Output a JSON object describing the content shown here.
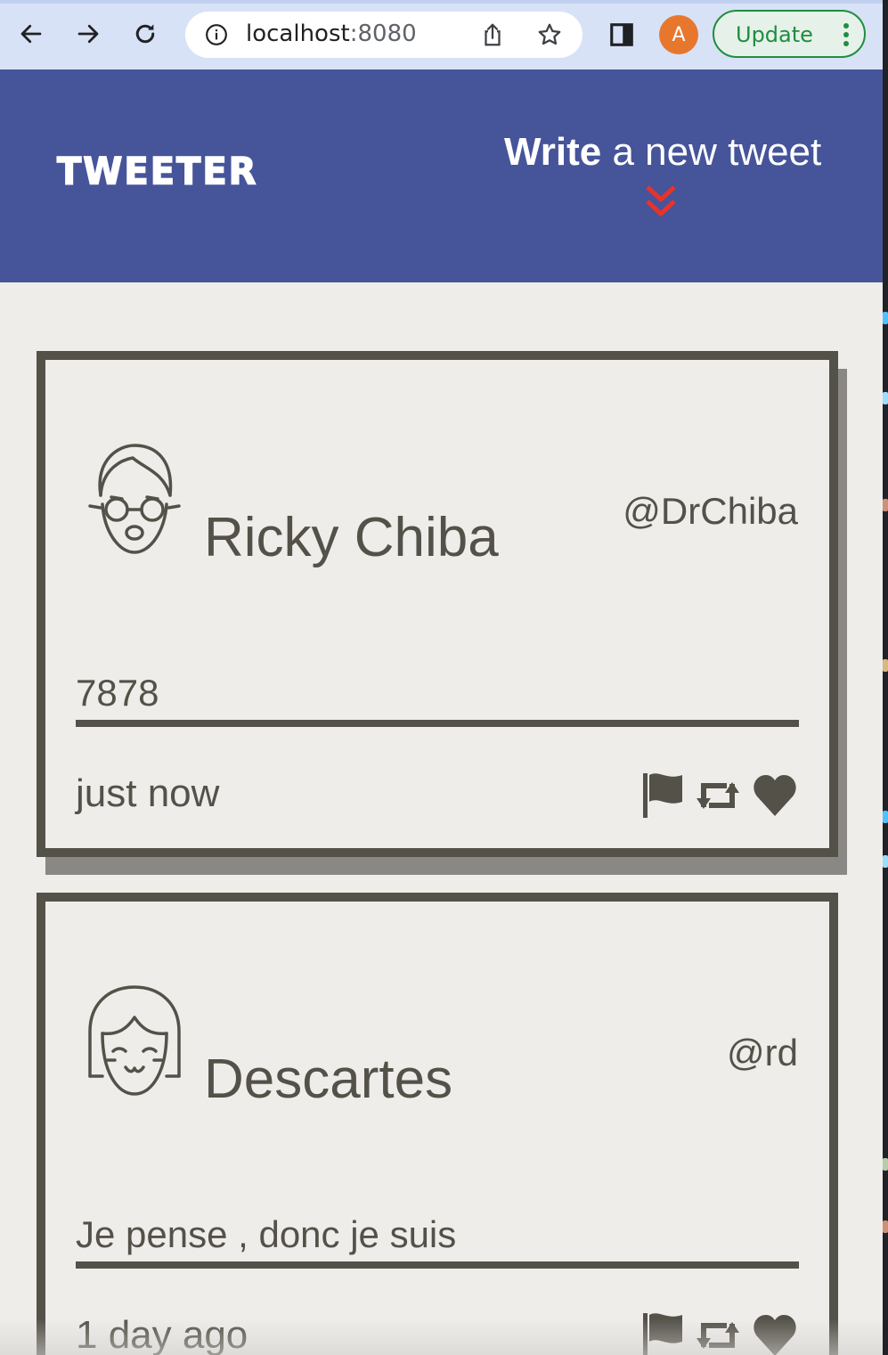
{
  "browser": {
    "url_host": "localhost",
    "url_port": ":8080",
    "profile_initial": "A",
    "update_label": "Update"
  },
  "header": {
    "brand": "TWEETER",
    "compose_bold": "Write",
    "compose_rest": " a new tweet"
  },
  "tweets": [
    {
      "name": "Ricky Chiba",
      "handle": "@DrChiba",
      "content": "7878",
      "time": "just now",
      "avatar": "boy-with-glasses-avatar-icon"
    },
    {
      "name": "Descartes",
      "handle": "@rd",
      "content": "Je pense , donc je suis",
      "time": "1 day ago",
      "avatar": "girl-with-bangs-avatar-icon"
    }
  ],
  "icons": [
    "back-icon",
    "forward-icon",
    "reload-icon",
    "info-icon",
    "share-icon",
    "star-icon",
    "side-panel-icon",
    "kebab-menu-icon",
    "double-chevron-down-icon",
    "flag-icon",
    "retweet-icon",
    "heart-icon"
  ],
  "colors": {
    "header_bg": "#46549a",
    "tweet_border": "#545149",
    "page_bg": "#efedea",
    "chevron": "#e8332a"
  }
}
